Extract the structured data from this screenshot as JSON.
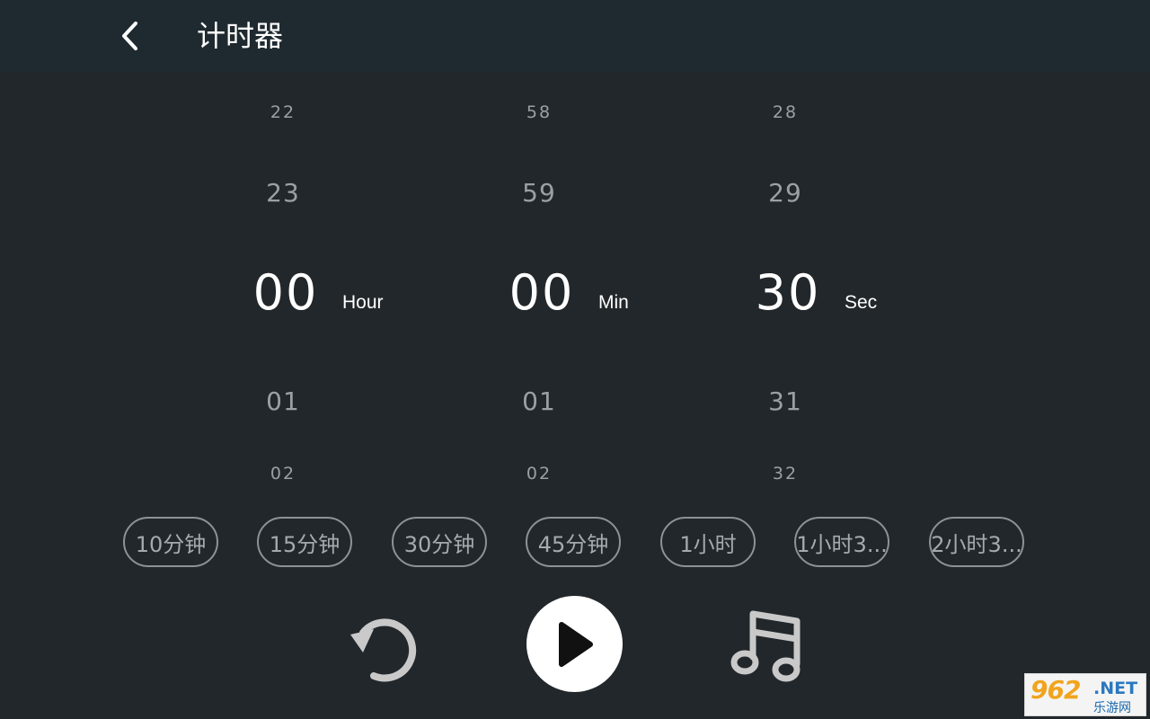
{
  "header": {
    "title": "计时器",
    "back_icon": "chevron-left-icon"
  },
  "pickers": {
    "hour": {
      "prev2": "22",
      "prev1": "23",
      "value": "00",
      "next1": "01",
      "next2": "02",
      "unit": "Hour"
    },
    "minute": {
      "prev2": "58",
      "prev1": "59",
      "value": "00",
      "next1": "01",
      "next2": "02",
      "unit": "Min"
    },
    "second": {
      "prev2": "28",
      "prev1": "29",
      "value": "30",
      "next1": "31",
      "next2": "32",
      "unit": "Sec"
    }
  },
  "presets": [
    {
      "label": "10分钟"
    },
    {
      "label": "15分钟"
    },
    {
      "label": "30分钟"
    },
    {
      "label": "45分钟"
    },
    {
      "label": "1小时"
    },
    {
      "label": "1小时3..."
    },
    {
      "label": "2小时3..."
    }
  ],
  "controls": {
    "reset_icon": "reset-icon",
    "play_icon": "play-icon",
    "music_icon": "music-note-icon"
  },
  "watermark": {
    "brand": "962",
    "suffix": ".NET",
    "sub": "乐游网"
  },
  "colors": {
    "background": "#22272b",
    "header": "#1f2a30",
    "selected_text": "#ffffff",
    "dim_text": "#9aa0a4"
  }
}
